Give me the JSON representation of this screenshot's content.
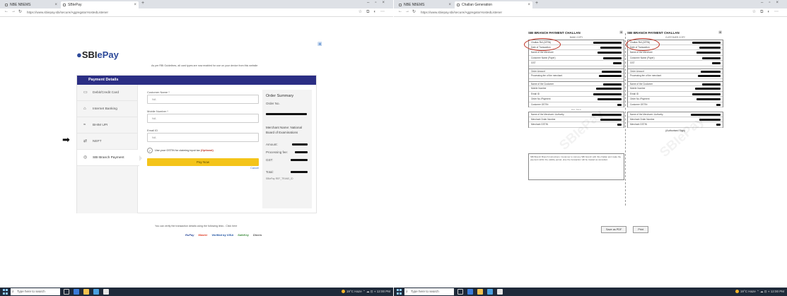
{
  "left": {
    "tabs": [
      {
        "label": "NBE NBEMS",
        "active": false
      },
      {
        "label": "SBIePay",
        "active": true
      }
    ],
    "url": "https://www.sbiepay.sbi/secure/AggregatorHostedListener",
    "logo": {
      "prefix": "SBI",
      "suffix": "ePay"
    },
    "notice": "As per RBI Guidelines, all card types are now enabled for use on your device from this website",
    "payment_details": "Payment Details",
    "menu": [
      {
        "label": "Debit/Credit Card",
        "icon": "card-icon"
      },
      {
        "label": "Internet Banking",
        "icon": "bank-icon"
      },
      {
        "label": "BHIM UPI",
        "icon": "upi-icon"
      },
      {
        "label": "NEFT",
        "icon": "neft-icon"
      },
      {
        "label": "SBI Branch Payment",
        "icon": "branch-icon"
      }
    ],
    "form": {
      "name_label": "Customer Name *",
      "name_value": "NA",
      "mobile_label": "Mobile Number *",
      "mobile_value": "NA",
      "email_label": "Email ID",
      "email_value": "NA",
      "gst_text": "Use your GSTIN for claiming input tax",
      "gst_optional": "(Optional)",
      "pay_label": "Pay Now",
      "cancel_label": "Cancel"
    },
    "summary": {
      "title": "Order Summary",
      "order_label": "Order No.",
      "merchant": "Merchant Name: National Board of Examinations",
      "amount_label": "Amount:",
      "fee_label": "Processing fee:",
      "gst_label": "GST:",
      "total_label": "Total:",
      "ref": "SBIePay REF_TRANS_ID"
    },
    "verify_text": "You can verify the transaction details using the following links - Click here",
    "payicons": [
      "RuPay",
      "Master",
      "Verified by VISA",
      "SafeKey",
      "Diners"
    ],
    "taskbar": {
      "search": "Type here to search",
      "weather": "19°C Haze",
      "time": "12:00 PM"
    }
  },
  "right": {
    "tabs": [
      {
        "label": "NBE NBEMS",
        "active": false
      },
      {
        "label": "Challan Generation",
        "active": true
      }
    ],
    "url": "https://www.sbiepay.sbi/secure/AggregatorHostedListener",
    "challan": {
      "title": "SBI BRANCH PAYMENT CHALLAN",
      "bank_copy": "BANK COPY",
      "customer_copy": "CUSTOMER COPY",
      "rows_a": [
        "Challan Ref (ATRN)",
        "Date of Transaction",
        "Name of the Merchant",
        "Customer Name (Payer)",
        "GST"
      ],
      "rows_b": [
        "Order Amount",
        "Processing fee of the merchant"
      ],
      "rows_c": [
        "Name of the Customer",
        "Mobile Number",
        "Email ID",
        "Order No./Payment",
        "Customer GSTIN"
      ],
      "rows_d": [
        "Name of the Merchant / Authority",
        "Merchant Order Number",
        "Merchant GSTIN"
      ],
      "ack": "(Authorised Sign)",
      "note": "SBI Branch Branch Instructions: Customer to visit any SBI branch with this challan and make the payment within the validity period, else the transaction will be treated as cancelled.",
      "watermark": "SBIePay",
      "dash": "Cut here"
    },
    "buttons": {
      "save": "Save as PDF",
      "print": "Print"
    },
    "taskbar": {
      "search": "Type here to search",
      "weather": "19°C Haze",
      "time": "12:00 PM"
    }
  }
}
